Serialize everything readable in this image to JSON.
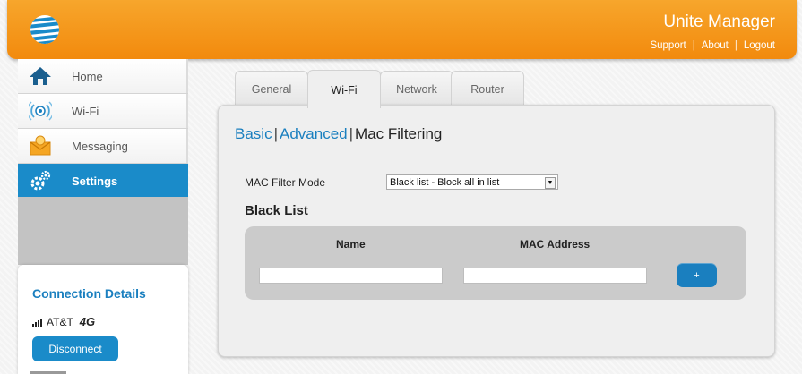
{
  "header": {
    "app_title": "Unite Manager",
    "links": [
      "Support",
      "About",
      "Logout"
    ],
    "logo_icon": "att-globe-icon"
  },
  "sidebar": {
    "items": [
      {
        "label": "Home",
        "icon": "home-icon",
        "active": false
      },
      {
        "label": "Wi-Fi",
        "icon": "wifi-icon",
        "active": false
      },
      {
        "label": "Messaging",
        "icon": "envelope-icon",
        "active": false
      },
      {
        "label": "Settings",
        "icon": "gears-icon",
        "active": true
      }
    ],
    "connection": {
      "title": "Connection Details",
      "carrier": "AT&T",
      "network_badge": "4G",
      "disconnect_label": "Disconnect"
    }
  },
  "tabs": [
    {
      "label": "General",
      "active": false
    },
    {
      "label": "Wi-Fi",
      "active": true
    },
    {
      "label": "Network",
      "active": false
    },
    {
      "label": "Router",
      "active": false
    }
  ],
  "subnav": {
    "basic": "Basic",
    "advanced": "Advanced",
    "current": "Mac Filtering"
  },
  "form": {
    "mode_label": "MAC Filter Mode",
    "mode_value": "Black list - Block all in list",
    "list_title": "Black List",
    "columns": [
      "Name",
      "MAC Address"
    ],
    "name_value": "",
    "mac_value": "",
    "add_label": "+"
  },
  "colors": {
    "header_orange": "#f28a0d",
    "accent_blue": "#1a8bc9",
    "link_blue": "#1a7fbf"
  }
}
